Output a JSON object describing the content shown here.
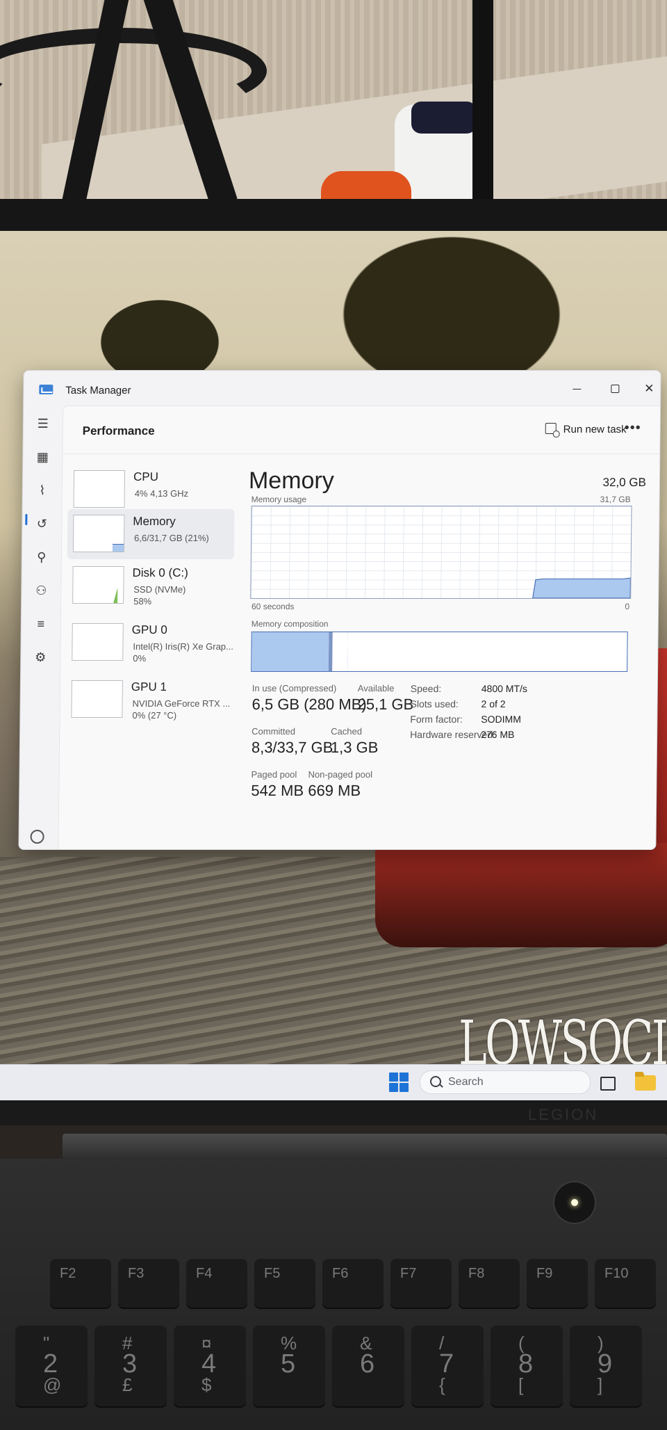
{
  "taskbar": {
    "search_placeholder": "Search"
  },
  "watermark": "LOWSOCIET",
  "laptop_brand": "LEGION",
  "keyboard": {
    "function_keys": [
      "F2",
      "F3",
      "F4",
      "F5",
      "F6",
      "F7",
      "F8",
      "F9",
      "F10"
    ],
    "number_keys": [
      {
        "top": "\"",
        "main": "2",
        "bottom": "@"
      },
      {
        "top": "#",
        "main": "3",
        "bottom": "£"
      },
      {
        "top": "¤",
        "main": "4",
        "bottom": "$"
      },
      {
        "top": "%",
        "main": "5",
        "bottom": ""
      },
      {
        "top": "&",
        "main": "6",
        "bottom": ""
      },
      {
        "top": "/",
        "main": "7",
        "bottom": "{"
      },
      {
        "top": "(",
        "main": "8",
        "bottom": "["
      },
      {
        "top": ")",
        "main": "9",
        "bottom": "]"
      }
    ]
  },
  "window": {
    "title": "Task Manager",
    "page_title": "Performance",
    "run_new_task": "Run new task",
    "more_label": "•••",
    "rail_icons": [
      "hamburger-menu-icon",
      "processes-icon",
      "performance-icon",
      "app-history-icon",
      "startup-apps-icon",
      "users-icon",
      "details-icon",
      "services-icon",
      "settings-icon"
    ]
  },
  "devices": [
    {
      "name": "CPU",
      "line1": "4%  4,13 GHz",
      "line2": ""
    },
    {
      "name": "Memory",
      "line1": "6,6/31,7 GB (21%)",
      "line2": "",
      "selected": true
    },
    {
      "name": "Disk 0 (C:)",
      "line1": "SSD (NVMe)",
      "line2": "58%"
    },
    {
      "name": "GPU 0",
      "line1": "Intel(R) Iris(R) Xe Grap...",
      "line2": "0%"
    },
    {
      "name": "GPU 1",
      "line1": "NVIDIA GeForce RTX ...",
      "line2": "0% (27 °C)"
    }
  ],
  "memory": {
    "title": "Memory",
    "total": "32,0 GB",
    "usage_label": "Memory usage",
    "usage_max": "31,7 GB",
    "time_left": "60 seconds",
    "time_right": "0",
    "composition_label": "Memory composition",
    "usage_history_fraction": [
      0,
      0,
      0,
      0,
      0,
      0,
      0,
      0,
      0,
      0,
      0,
      0,
      0,
      0,
      0,
      0,
      0,
      0,
      0,
      0,
      0,
      0,
      0,
      0,
      0,
      0,
      0,
      0,
      0,
      0,
      0,
      0,
      0,
      0,
      0,
      0,
      0,
      0,
      0,
      0.2,
      0.21,
      0.21,
      0.21,
      0.21,
      0.21,
      0.21,
      0.21,
      0.21,
      0.21,
      0.21,
      0.21,
      0.21,
      0.22
    ],
    "composition": {
      "in_use_fraction": 0.205,
      "modified_fraction": 0.01,
      "standby_fraction": 0.04,
      "free_fraction": 0.745
    },
    "stats": {
      "in_use_label": "In use (Compressed)",
      "in_use_value": "6,5 GB (280 MB)",
      "available_label": "Available",
      "available_value": "25,1 GB",
      "committed_label": "Committed",
      "committed_value": "8,3/33,7 GB",
      "cached_label": "Cached",
      "cached_value": "1,3 GB",
      "paged_label": "Paged pool",
      "paged_value": "542 MB",
      "nonpaged_label": "Non-paged pool",
      "nonpaged_value": "669 MB"
    },
    "specs": [
      {
        "key": "Speed:",
        "value": "4800 MT/s"
      },
      {
        "key": "Slots used:",
        "value": "2 of 2"
      },
      {
        "key": "Form factor:",
        "value": "SODIMM"
      },
      {
        "key": "Hardware reserved:",
        "value": "276 MB"
      }
    ]
  },
  "colors": {
    "memory_fill": "#abc8ee",
    "memory_line": "#4a6fb6",
    "accent": "#1f6fd4",
    "disk_fill": "#7fbf5a"
  }
}
